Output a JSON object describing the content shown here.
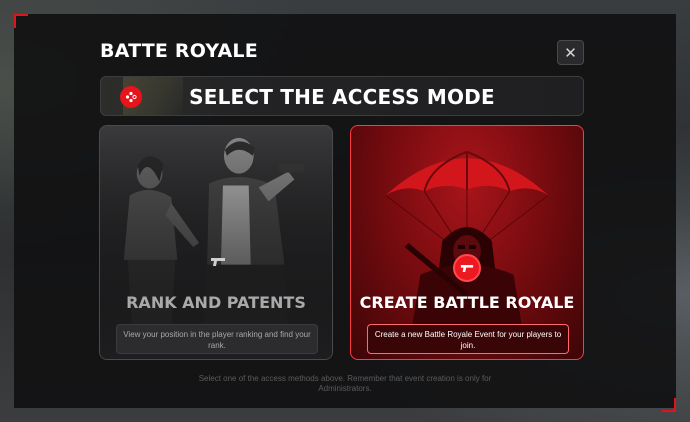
{
  "window": {
    "title": "BATTE ROYALE"
  },
  "header": {
    "mode_title": "SELECT THE ACCESS MODE",
    "close_icon": "close-icon",
    "banner_icon": "gamepad-icon"
  },
  "cards": [
    {
      "title": "RANK AND PATENTS",
      "description": "View your position in the player ranking and find your rank.",
      "icon": "pistol-icon"
    },
    {
      "title": "CREATE BATTLE ROYALE",
      "description": "Create a new Battle Royale Event for your players to join.",
      "icon": "pistol-icon"
    }
  ],
  "footer": {
    "note": "Select one of the access methods above. Remember that event creation is only for Administrators."
  },
  "colors": {
    "accent": "#e8141b",
    "panel": "#111112",
    "card_dark": "#2b2b2d"
  }
}
